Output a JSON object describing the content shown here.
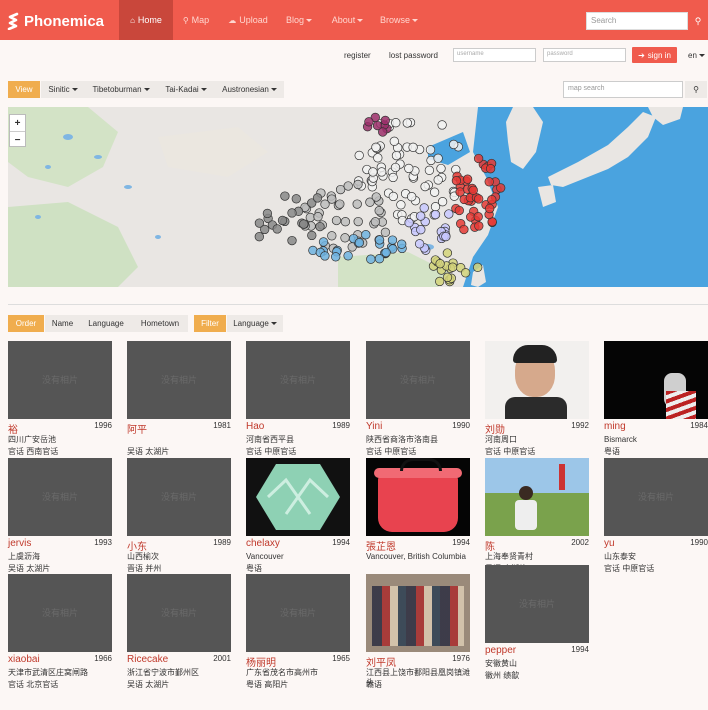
{
  "navbar": {
    "brand": "Phonemica",
    "items": [
      {
        "icon": "⌂",
        "label": "Home"
      },
      {
        "icon": "⚲",
        "label": "Map"
      },
      {
        "icon": "☁",
        "label": "Upload"
      },
      {
        "icon": "",
        "label": "Blog"
      },
      {
        "icon": "",
        "label": "About"
      },
      {
        "icon": "",
        "label": "Browse"
      }
    ],
    "search_placeholder": "Search"
  },
  "auth": {
    "register": "register",
    "lost_password": "lost password",
    "username_placeholder": "username",
    "password_placeholder": "password",
    "sign_in": "sign in",
    "lang": "en"
  },
  "filters": {
    "view": "View",
    "families": [
      "Sinitic",
      "Tibetoburman",
      "Tai-Kadai",
      "Austronesian"
    ],
    "map_search_placeholder": "map search"
  },
  "sort": {
    "order": "Order",
    "options": [
      "Name",
      "Language",
      "Hometown"
    ],
    "filter": "Filter",
    "filter_option": "Language"
  },
  "no_photo_text": "没有相片",
  "speakers": [
    {
      "name": "裕",
      "year": "1996",
      "place": "四川广安岳池",
      "lang": "官话 西南官话"
    },
    {
      "name": "阿平",
      "year": "1981",
      "place": "",
      "lang": "吴语 太湖片"
    },
    {
      "name": "Hao",
      "year": "1989",
      "place": "河南省西平县",
      "lang": "官话 中原官话"
    },
    {
      "name": "Yini",
      "year": "1990",
      "place": "陕西省商洛市洛南县",
      "lang": "官话 中原官话"
    },
    {
      "name": "刘勋",
      "year": "1992",
      "place": "河南周口",
      "lang": "官话 中原官话"
    },
    {
      "name": "ming",
      "year": "1984",
      "place": "Bismarck",
      "lang": "粤语"
    },
    {
      "name": "jervis",
      "year": "1993",
      "place": "上虞沥海",
      "lang": "吴语 太湖片"
    },
    {
      "name": "小东",
      "year": "1989",
      "place": "山西榆次",
      "lang": "晋语 并州"
    },
    {
      "name": "chelaxy",
      "year": "1994",
      "place": "Vancouver",
      "lang": "粤语"
    },
    {
      "name": "張芷恩",
      "year": "1994",
      "place": "Vancouver, British Columbia",
      "lang": ""
    },
    {
      "name": "陈",
      "year": "2002",
      "place": "上海奉贤青村",
      "lang": "吴语 太湖片"
    },
    {
      "name": "yu",
      "year": "1990",
      "place": "山东泰安",
      "lang": "官话 中原官话"
    },
    {
      "name": "xiaobai",
      "year": "1966",
      "place": "天津市武清区庄窝闸路",
      "lang": "官话 北京官话"
    },
    {
      "name": "Ricecake",
      "year": "2001",
      "place": "浙江省宁波市鄞州区",
      "lang": "吴语 太湖片"
    },
    {
      "name": "杨丽明",
      "year": "1965",
      "place": "广东省茂名市高州市",
      "lang": "粤语 高阳片"
    },
    {
      "name": "刘平凤",
      "year": "1976",
      "place": "江西县上饶市鄱阳县凰岗镇滩头",
      "lang": "赣语"
    },
    {
      "name": "pepper",
      "year": "1994",
      "place": "安徽黄山",
      "lang": "徽州 绩歙"
    }
  ],
  "colors": {
    "accent": "#f05b4d",
    "accent_dark": "#c9473b",
    "orange": "#f0ad4e",
    "name_red": "#c0392b",
    "sea": "#4aa3df"
  }
}
